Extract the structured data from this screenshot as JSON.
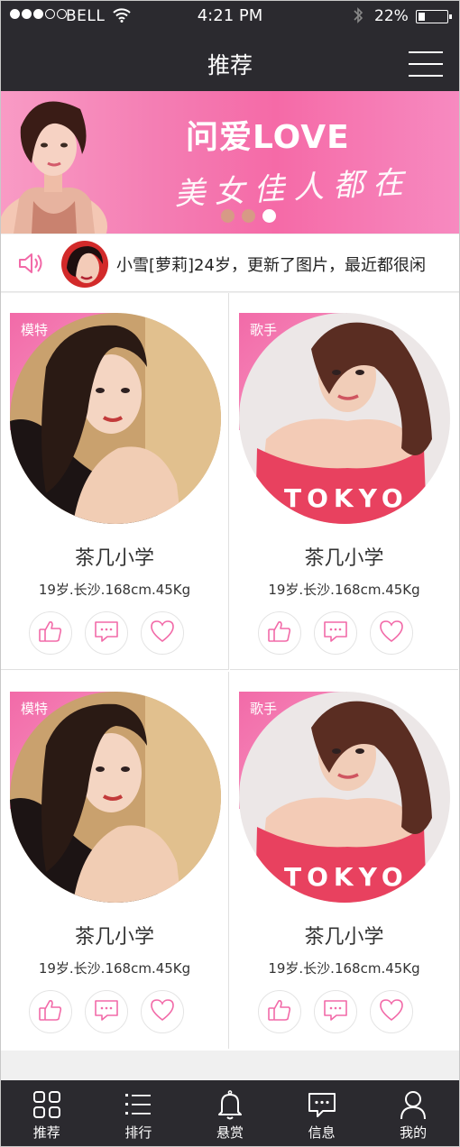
{
  "status_bar": {
    "carrier": "BELL",
    "time": "4:21 PM",
    "battery": "22%"
  },
  "nav": {
    "title": "推荐",
    "menu_icon": "hamburger-menu-icon"
  },
  "banner": {
    "title": "问爱LOVE",
    "subtitle": "美女佳人都在",
    "pages": 3,
    "active_page": 3
  },
  "notice": {
    "text": "小雪[萝莉]24岁，更新了图片，最近都很闲",
    "icon": "speaker-icon"
  },
  "cards": [
    {
      "tag": "模特",
      "name": "茶几小学",
      "info": "19岁.长沙.168cm.45Kg"
    },
    {
      "tag": "歌手",
      "name": "茶几小学",
      "info": "19岁.长沙.168cm.45Kg",
      "shirt_text": "TOKYO"
    },
    {
      "tag": "模特",
      "name": "茶几小学",
      "info": "19岁.长沙.168cm.45Kg"
    },
    {
      "tag": "歌手",
      "name": "茶几小学",
      "info": "19岁.长沙.168cm.45Kg",
      "shirt_text": "TOKYO"
    }
  ],
  "card_actions": [
    "thumbs-up-icon",
    "comment-icon",
    "heart-icon"
  ],
  "tabbar": [
    {
      "label": "推荐",
      "icon": "grid-icon"
    },
    {
      "label": "排行",
      "icon": "list-icon"
    },
    {
      "label": "悬赏",
      "icon": "bell-icon"
    },
    {
      "label": "信息",
      "icon": "message-icon"
    },
    {
      "label": "我的",
      "icon": "user-icon"
    }
  ],
  "colors": {
    "accent_pink": "#f26aa8",
    "dark_bar": "#2b2a2f"
  }
}
